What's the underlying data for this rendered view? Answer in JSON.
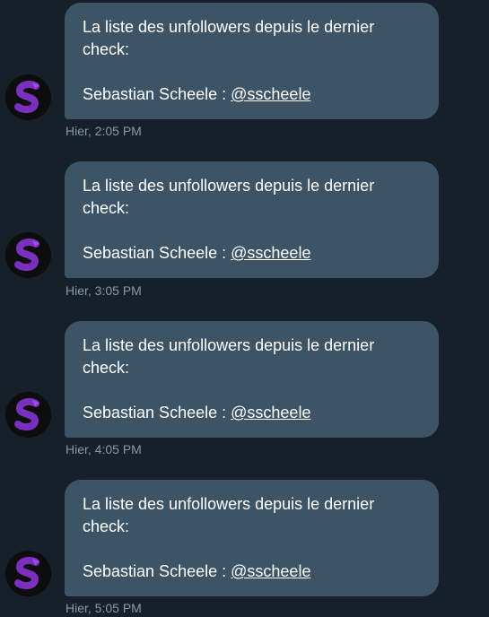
{
  "messages": [
    {
      "line1": "La liste des unfollowers depuis le dernier check:",
      "name": "Sebastian Scheele :",
      "handle": "@sscheele",
      "timestamp": "Hier, 2:05 PM"
    },
    {
      "line1": "La liste des unfollowers depuis le dernier check:",
      "name": "Sebastian Scheele :",
      "handle": "@sscheele",
      "timestamp": "Hier, 3:05 PM"
    },
    {
      "line1": "La liste des unfollowers depuis le dernier check:",
      "name": "Sebastian Scheele :",
      "handle": "@sscheele",
      "timestamp": "Hier, 4:05 PM"
    },
    {
      "line1": "La liste des unfollowers depuis le dernier check:",
      "name": "Sebastian Scheele :",
      "handle": "@sscheele",
      "timestamp": "Hier, 5:05 PM"
    }
  ],
  "colors": {
    "background": "#15202b",
    "bubble": "#3d5466",
    "timestamp": "#8899a6",
    "avatar_accent": "#7b2fbe"
  },
  "icons": {
    "avatar": "purple-s-logo-icon"
  }
}
